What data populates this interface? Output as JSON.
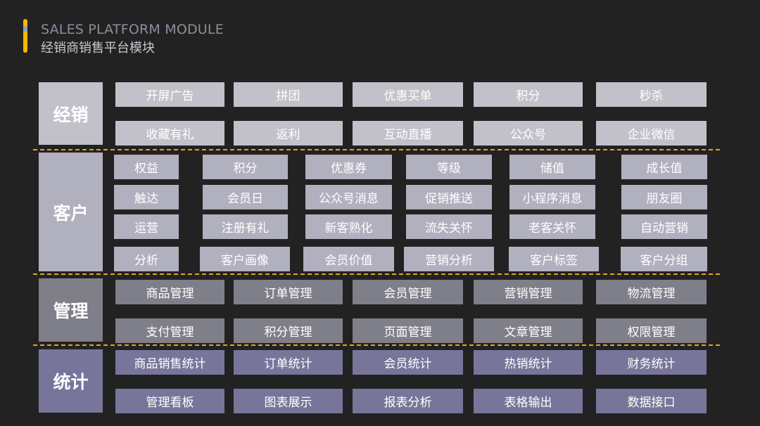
{
  "header": {
    "title_en": "SALES PLATFORM MODULE",
    "title_cn": "经销商销售平台模块"
  },
  "colors": {
    "background": "#222222",
    "accent": "#f5b700",
    "separator": "#e8a41a",
    "group1_fill": "#c2c1ca",
    "group2_fill": "#b1b0be",
    "group3_fill": "#7f7f8a",
    "group4_fill": "#77769a"
  },
  "groups": [
    {
      "label": "经销",
      "rows": [
        [
          "开屏广告",
          "拼团",
          "优惠买单",
          "积分",
          "秒杀"
        ],
        [
          "收藏有礼",
          "返利",
          "互动直播",
          "公众号",
          "企业微信"
        ]
      ]
    },
    {
      "label": "客户",
      "rows": [
        [
          "权益",
          "积分",
          "优惠券",
          "等级",
          "储值",
          "成长值"
        ],
        [
          "触达",
          "会员日",
          "公众号消息",
          "促销推送",
          "小程序消息",
          "朋友圈"
        ],
        [
          "运营",
          "注册有礼",
          "新客熟化",
          "流失关怀",
          "老客关怀",
          "自动营销"
        ],
        [
          "分析",
          "客户画像",
          "会员价值",
          "营销分析",
          "客户标签",
          "客户分组"
        ]
      ]
    },
    {
      "label": "管理",
      "rows": [
        [
          "商品管理",
          "订单管理",
          "会员管理",
          "营销管理",
          "物流管理"
        ],
        [
          "支付管理",
          "积分管理",
          "页面管理",
          "文章管理",
          "权限管理"
        ]
      ]
    },
    {
      "label": "统计",
      "rows": [
        [
          "商品销售统计",
          "订单统计",
          "会员统计",
          "热销统计",
          "财务统计"
        ],
        [
          "管理看板",
          "图表展示",
          "报表分析",
          "表格输出",
          "数据接口"
        ]
      ]
    }
  ]
}
